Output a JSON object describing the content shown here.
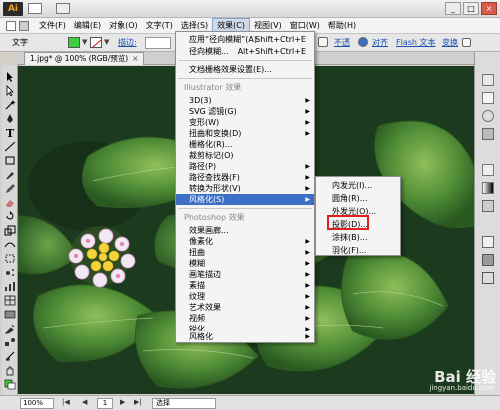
{
  "app": {
    "logo": "Ai",
    "document_tab": "1.jpg* @ 100% (RGB/预览)",
    "close": "×"
  },
  "menubar": [
    "文件(F)",
    "编辑(E)",
    "对象(O)",
    "文字(T)",
    "选择(S)",
    "效果(C)",
    "视图(V)",
    "窗口(W)",
    "帮助(H)"
  ],
  "controlbar": {
    "label": "文字",
    "stroke_label": "描边:",
    "opacity_link": "不透",
    "align_link": "对齐",
    "flash_link": "Flash 文本",
    "transform_link": "变换"
  },
  "effect_menu": {
    "top_items": [
      {
        "label": "应用“径向模糊”(A)",
        "shortcut": "Shift+Ctrl+E"
      },
      {
        "label": "径向模糊...",
        "shortcut": "Alt+Shift+Ctrl+E"
      }
    ],
    "settings_item": "文档栅格效果设置(E)...",
    "illustrator_header": "Illustrator 效果",
    "illustrator_items": [
      "3D(3)",
      "SVG 滤镜(G)",
      "变形(W)",
      "扭曲和变换(D)",
      "栅格化(R)...",
      "裁剪标记(O)",
      "路径(P)",
      "路径查找器(F)",
      "转换为形状(V)",
      "风格化(S)"
    ],
    "photoshop_header": "Photoshop 效果",
    "photoshop_items": [
      "效果画廊...",
      "像素化",
      "扭曲",
      "模糊",
      "画笔描边",
      "素描",
      "纹理",
      "艺术效果",
      "视频",
      "锐化",
      "风格化"
    ]
  },
  "stylize_submenu": [
    "内发光(I)...",
    "圆角(R)...",
    "外发光(O)...",
    "投影(D)...",
    "涂抹(B)...",
    "羽化(F)..."
  ],
  "statusbar": {
    "zoom": "100%",
    "page": "1",
    "mode": "选择",
    "nav_first": "|◀",
    "nav_prev": "◀",
    "nav_next": "▶",
    "nav_last": "▶|"
  },
  "watermark": {
    "logo": "Bai 经验",
    "site": "jingyan.baidu.com"
  },
  "colors": {
    "highlight": "#3d6fc6",
    "red_box": "#e0201c",
    "fill_swatch": "#3ad23a"
  }
}
